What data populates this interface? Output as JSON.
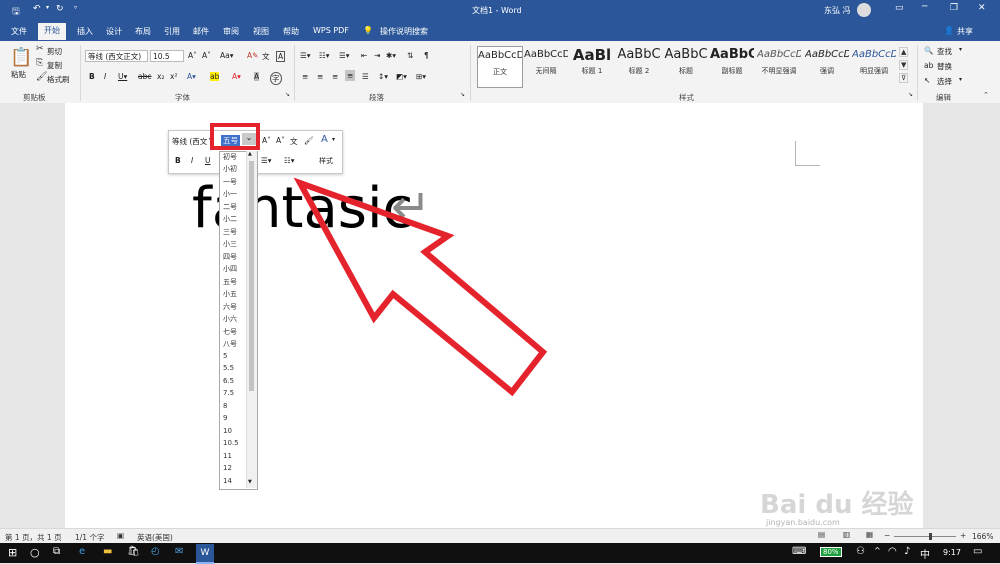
{
  "window": {
    "doc_title": "文档1 - Word",
    "user_name": "东弘 冯",
    "share": "共享",
    "quick_access": [
      "save-icon",
      "undo-icon",
      "redo-icon",
      "customize-icon"
    ]
  },
  "tabs": [
    "文件",
    "开始",
    "插入",
    "设计",
    "布局",
    "引用",
    "邮件",
    "审阅",
    "视图",
    "帮助",
    "WPS PDF"
  ],
  "tell_me": "操作说明搜索",
  "ribbon": {
    "clipboard": {
      "paste": "粘贴",
      "cut": "剪切",
      "copy": "复制",
      "format_painter": "格式刷",
      "label": "剪贴板"
    },
    "font": {
      "name": "等线 (西文正文)",
      "size": "10.5",
      "label": "字体"
    },
    "paragraph": {
      "label": "段落"
    },
    "styles": {
      "label": "样式",
      "items": [
        {
          "sample": "AaBbCcDd",
          "name": "正文"
        },
        {
          "sample": "AaBbCcDd",
          "name": "无间隔"
        },
        {
          "sample": "AaBl",
          "name": "标题 1"
        },
        {
          "sample": "AaBbC",
          "name": "标题 2"
        },
        {
          "sample": "AaBbC",
          "name": "标题"
        },
        {
          "sample": "AaBbC",
          "name": "副标题"
        },
        {
          "sample": "AaBbCcDd",
          "name": "不明显强调"
        },
        {
          "sample": "AaBbCcDd",
          "name": "强调"
        },
        {
          "sample": "AaBbCcDd",
          "name": "明显强调"
        }
      ]
    },
    "editing": {
      "find": "查找",
      "replace": "替换",
      "select": "选择",
      "label": "编辑"
    }
  },
  "mini_toolbar": {
    "font": "等线 (西文",
    "size": "五号",
    "styles_label": "样式"
  },
  "size_options": [
    "初号",
    "小初",
    "一号",
    "小一",
    "二号",
    "小二",
    "三号",
    "小三",
    "四号",
    "小四",
    "五号",
    "小五",
    "六号",
    "小六",
    "七号",
    "八号",
    "5",
    "5.5",
    "6.5",
    "7.5",
    "8",
    "9",
    "10",
    "10.5",
    "11",
    "12",
    "14"
  ],
  "document": {
    "text": "fantasic",
    "return_mark": "↵"
  },
  "status": {
    "page": "第 1 页，共 1 页",
    "words": "1/1 个字",
    "lang": "英语(美国)",
    "zoom": "166%"
  },
  "taskbar": {
    "battery": "80%",
    "time": "9:17"
  },
  "watermark": {
    "brand": "Bai du 经验",
    "url": "jingyan.baidu.com"
  },
  "colors": {
    "accent": "#2b579a",
    "highlight": "#e5232c"
  }
}
